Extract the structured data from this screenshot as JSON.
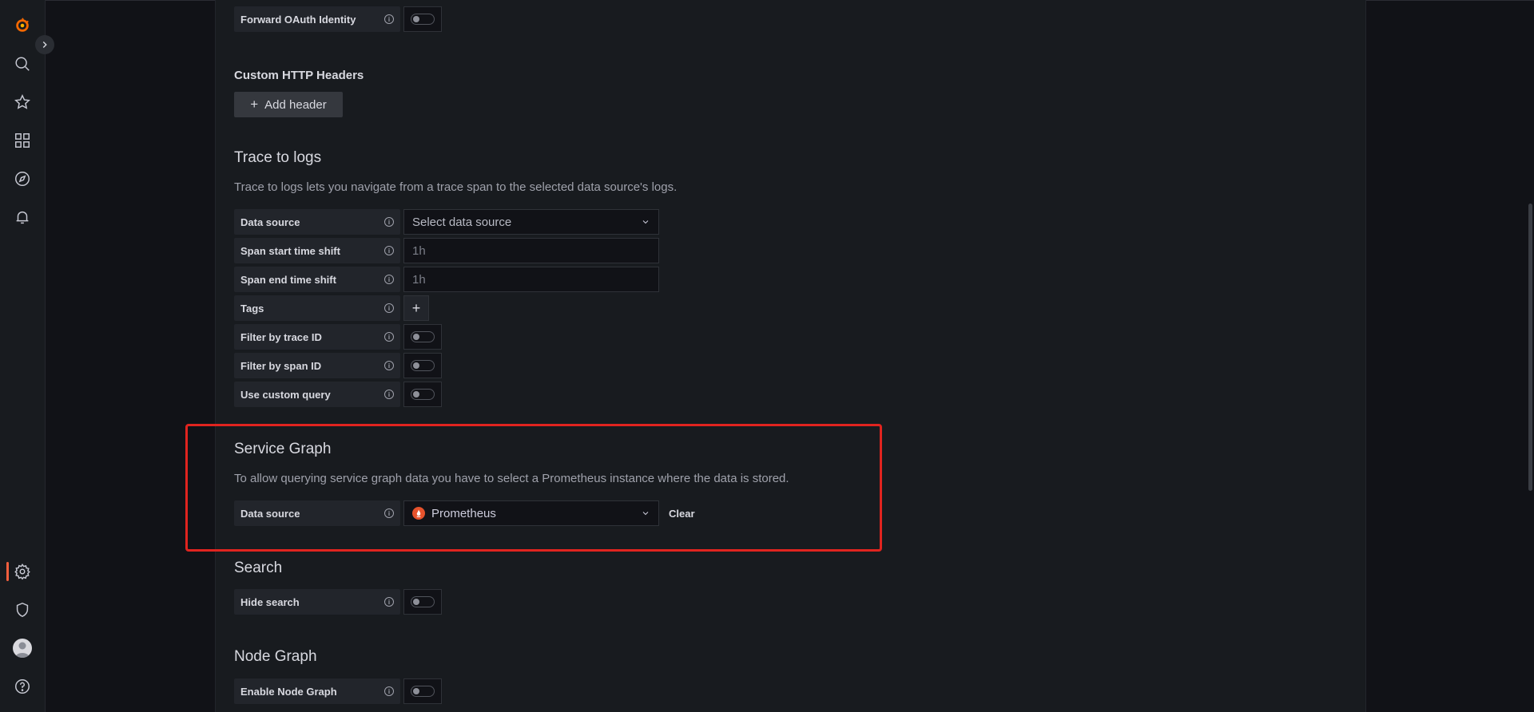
{
  "sidebar": {
    "icons": [
      "grafana-logo-icon",
      "search-icon",
      "star-icon",
      "dashboards-icon",
      "explore-icon",
      "alerting-icon",
      "gear-icon",
      "shield-icon",
      "avatar",
      "help-icon"
    ]
  },
  "colors": {
    "accent": "#f55f3e",
    "highlight_border": "#e0241f",
    "prometheus": "#e6522c"
  },
  "oauth": {
    "label": "Forward OAuth Identity",
    "enabled": false
  },
  "custom_headers": {
    "title": "Custom HTTP Headers",
    "add_label": "Add header"
  },
  "trace_to_logs": {
    "title": "Trace to logs",
    "description": "Trace to logs lets you navigate from a trace span to the selected data source's logs.",
    "data_source_label": "Data source",
    "data_source_placeholder": "Select data source",
    "span_start_label": "Span start time shift",
    "span_start_placeholder": "1h",
    "span_end_label": "Span end time shift",
    "span_end_placeholder": "1h",
    "tags_label": "Tags",
    "filter_trace_label": "Filter by trace ID",
    "filter_span_label": "Filter by span ID",
    "custom_query_label": "Use custom query"
  },
  "service_graph": {
    "title": "Service Graph",
    "description": "To allow querying service graph data you have to select a Prometheus instance where the data is stored.",
    "data_source_label": "Data source",
    "data_source_value": "Prometheus",
    "clear_label": "Clear"
  },
  "search": {
    "title": "Search",
    "hide_label": "Hide search"
  },
  "node_graph": {
    "title": "Node Graph",
    "enable_label": "Enable Node Graph"
  }
}
